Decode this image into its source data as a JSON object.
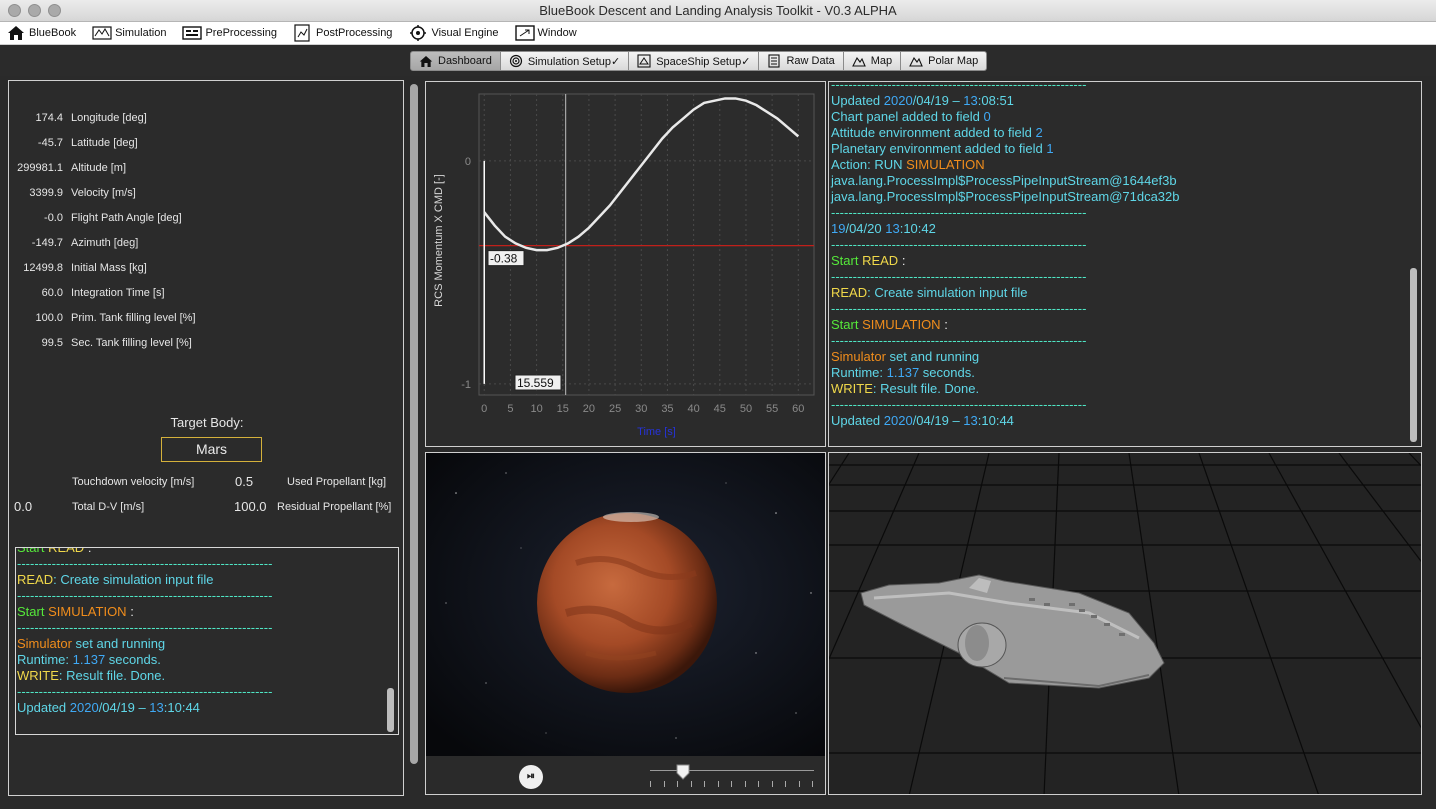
{
  "window": {
    "title": "BlueBook Descent and Landing Analysis Toolkit - V0.3 ALPHA"
  },
  "menu": [
    {
      "label": "BlueBook",
      "icon": "home-icon"
    },
    {
      "label": "Simulation",
      "icon": "simulation-icon"
    },
    {
      "label": "PreProcessing",
      "icon": "preprocessing-icon"
    },
    {
      "label": "PostProcessing",
      "icon": "postprocessing-icon"
    },
    {
      "label": "Visual Engine",
      "icon": "visual-engine-icon"
    },
    {
      "label": "Window",
      "icon": "window-icon"
    }
  ],
  "tabs": [
    {
      "label": "Dashboard",
      "icon": "home-icon",
      "active": true
    },
    {
      "label": "Simulation Setup✓",
      "icon": "settings-icon",
      "active": false
    },
    {
      "label": "SpaceShip Setup✓",
      "icon": "spaceship-icon",
      "active": false
    },
    {
      "label": "Raw Data",
      "icon": "raw-data-icon",
      "active": false
    },
    {
      "label": "Map",
      "icon": "map-icon",
      "active": false
    },
    {
      "label": "Polar Map",
      "icon": "polar-map-icon",
      "active": false
    }
  ],
  "params": [
    {
      "value": "174.4",
      "label": "Longitude [deg]"
    },
    {
      "value": "-45.7",
      "label": "Latitude [deg]"
    },
    {
      "value": "299981.1",
      "label": "Altitude [m]"
    },
    {
      "value": "3399.9",
      "label": "Velocity [m/s]"
    },
    {
      "value": "-0.0",
      "label": "Flight Path Angle [deg]"
    },
    {
      "value": "-149.7",
      "label": "Azimuth [deg]"
    },
    {
      "value": "12499.8",
      "label": "Initial Mass [kg]"
    },
    {
      "value": "60.0",
      "label": "Integration Time [s]"
    },
    {
      "value": "100.0",
      "label": "Prim. Tank filling level [%]"
    },
    {
      "value": "99.5",
      "label": "Sec. Tank filling level [%]"
    }
  ],
  "target": {
    "label": "Target Body:",
    "value": "Mars"
  },
  "results": {
    "touchdown_label": "Touchdown velocity [m/s]",
    "touchdown_value": "",
    "used_prop_value": "0.5",
    "used_prop_label": "Used Propellant [kg]",
    "total_dv_value": "0.0",
    "total_dv_label": "Total D-V [m/s]",
    "residual_value": "100.0",
    "residual_label": "Residual Propellant [%]"
  },
  "left_log": [
    [
      {
        "t": "Start ",
        "c": "green"
      },
      {
        "t": "READ",
        "c": "yellow"
      },
      {
        "t": " :",
        "c": "white"
      }
    ],
    [
      {
        "t": "-----------------------------------------------------------",
        "c": "teal"
      }
    ],
    [
      {
        "t": "READ",
        "c": "yellow"
      },
      {
        "t": ": Create simulation input file",
        "c": "cyan"
      }
    ],
    [
      {
        "t": "-----------------------------------------------------------",
        "c": "teal"
      }
    ],
    [
      {
        "t": "Start ",
        "c": "green"
      },
      {
        "t": "SIMULATION",
        "c": "orange"
      },
      {
        "t": " :",
        "c": "white"
      }
    ],
    [
      {
        "t": "-----------------------------------------------------------",
        "c": "teal"
      }
    ],
    [
      {
        "t": "Simulator",
        "c": "orange"
      },
      {
        "t": " set and running",
        "c": "cyan"
      }
    ],
    [
      {
        "t": "Runtime: ",
        "c": "cyan"
      },
      {
        "t": "1.137",
        "c": "blue"
      },
      {
        "t": " seconds.",
        "c": "cyan"
      }
    ],
    [
      {
        "t": "WRITE",
        "c": "yellow"
      },
      {
        "t": ": Result file. Done.",
        "c": "cyan"
      }
    ],
    [
      {
        "t": "-----------------------------------------------------------",
        "c": "teal"
      }
    ],
    [
      {
        "t": "Updated ",
        "c": "cyan"
      },
      {
        "t": "2020",
        "c": "blue"
      },
      {
        "t": "/04/19 – ",
        "c": "cyan"
      },
      {
        "t": "13",
        "c": "blue"
      },
      {
        "t": ":10:44",
        "c": "cyan"
      }
    ]
  ],
  "right_log": [
    [
      {
        "t": "-----------------------------------------------------------",
        "c": "teal"
      }
    ],
    [
      {
        "t": "Updated ",
        "c": "cyan"
      },
      {
        "t": "2020",
        "c": "blue"
      },
      {
        "t": "/04/19 – ",
        "c": "cyan"
      },
      {
        "t": "13",
        "c": "blue"
      },
      {
        "t": ":08:51",
        "c": "cyan"
      }
    ],
    [
      {
        "t": "Chart panel added to field ",
        "c": "cyan"
      },
      {
        "t": "0",
        "c": "blue"
      }
    ],
    [
      {
        "t": "Attitude environment added to field ",
        "c": "cyan"
      },
      {
        "t": "2",
        "c": "blue"
      }
    ],
    [
      {
        "t": "Planetary environment added to field ",
        "c": "cyan"
      },
      {
        "t": "1",
        "c": "blue"
      }
    ],
    [
      {
        "t": "Action: RUN ",
        "c": "cyan"
      },
      {
        "t": "SIMULATION",
        "c": "orange"
      }
    ],
    [
      {
        "t": "java.lang.ProcessImpl$ProcessPipeInputStream@1644ef3b",
        "c": "cyan"
      }
    ],
    [
      {
        "t": "java.lang.ProcessImpl$ProcessPipeInputStream@71dca32b",
        "c": "cyan"
      }
    ],
    [
      {
        "t": "-----------------------------------------------------------",
        "c": "teal"
      }
    ],
    [
      {
        "t": "19",
        "c": "blue"
      },
      {
        "t": "/04/20 ",
        "c": "cyan"
      },
      {
        "t": "13",
        "c": "blue"
      },
      {
        "t": ":10:42",
        "c": "cyan"
      }
    ],
    [
      {
        "t": "-----------------------------------------------------------",
        "c": "teal"
      }
    ],
    [
      {
        "t": "Start ",
        "c": "green"
      },
      {
        "t": "READ",
        "c": "yellow"
      },
      {
        "t": " :",
        "c": "white"
      }
    ],
    [
      {
        "t": "-----------------------------------------------------------",
        "c": "teal"
      }
    ],
    [
      {
        "t": "READ",
        "c": "yellow"
      },
      {
        "t": ": Create simulation input file",
        "c": "cyan"
      }
    ],
    [
      {
        "t": "-----------------------------------------------------------",
        "c": "teal"
      }
    ],
    [
      {
        "t": "Start ",
        "c": "green"
      },
      {
        "t": "SIMULATION",
        "c": "orange"
      },
      {
        "t": " :",
        "c": "white"
      }
    ],
    [
      {
        "t": "-----------------------------------------------------------",
        "c": "teal"
      }
    ],
    [
      {
        "t": "Simulator",
        "c": "orange"
      },
      {
        "t": " set and running",
        "c": "cyan"
      }
    ],
    [
      {
        "t": "Runtime: ",
        "c": "cyan"
      },
      {
        "t": "1.137",
        "c": "blue"
      },
      {
        "t": " seconds.",
        "c": "cyan"
      }
    ],
    [
      {
        "t": "WRITE",
        "c": "yellow"
      },
      {
        "t": ": Result file. Done.",
        "c": "cyan"
      }
    ],
    [
      {
        "t": "-----------------------------------------------------------",
        "c": "teal"
      }
    ],
    [
      {
        "t": "Updated ",
        "c": "cyan"
      },
      {
        "t": "2020",
        "c": "blue"
      },
      {
        "t": "/04/19 – ",
        "c": "cyan"
      },
      {
        "t": "13",
        "c": "blue"
      },
      {
        "t": ":10:44",
        "c": "cyan"
      }
    ]
  ],
  "chart_data": {
    "type": "line",
    "title": "",
    "xlabel": "Time [s]",
    "ylabel": "RCS Momentum X CMD [-]",
    "xlim": [
      -1,
      63
    ],
    "ylim": [
      -1.05,
      0.3
    ],
    "xticks": [
      0,
      5,
      10,
      15,
      20,
      25,
      30,
      35,
      40,
      45,
      50,
      55,
      60
    ],
    "yticks": [
      0,
      -1
    ],
    "series": [
      {
        "x": [
          0,
          2,
          4,
          6,
          8,
          10,
          12,
          14,
          16,
          18,
          20,
          22,
          24,
          26,
          28,
          30,
          32,
          34,
          36,
          38,
          40,
          42,
          44,
          46,
          48,
          50,
          52,
          54,
          56,
          58,
          60
        ],
        "values": [
          -0.23,
          -0.29,
          -0.34,
          -0.37,
          -0.39,
          -0.4,
          -0.4,
          -0.39,
          -0.37,
          -0.34,
          -0.3,
          -0.25,
          -0.2,
          -0.14,
          -0.08,
          -0.02,
          0.04,
          0.1,
          0.15,
          0.19,
          0.23,
          0.26,
          0.27,
          0.28,
          0.28,
          0.27,
          0.25,
          0.22,
          0.19,
          0.15,
          0.11
        ]
      }
    ],
    "hline": -0.38,
    "vline": 15.559,
    "cursor_labels": {
      "y": "-0.38",
      "x": "15.559"
    },
    "colors": {
      "line": "#e9e9e9",
      "hline": "#c0201a",
      "axis_label": "#2633d8"
    }
  },
  "playback": {
    "play_label": "⏯",
    "slider_fraction": 0.2
  },
  "colors": {
    "background": "#2b2b2b",
    "target_border": "#d4b13b"
  }
}
